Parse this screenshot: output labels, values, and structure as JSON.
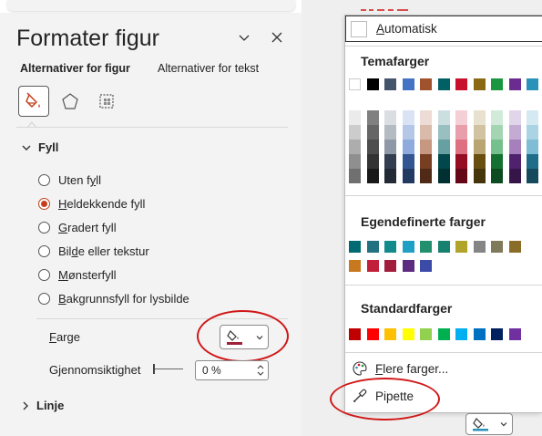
{
  "pane": {
    "title": "Formater figur",
    "tabs": [
      {
        "label": "Alternativer for figur",
        "active": true
      },
      {
        "label": "Alternativer for tekst",
        "active": false
      }
    ],
    "icon_tabs": [
      "fill-line-icon",
      "effects-pentagon-icon",
      "size-properties-icon"
    ],
    "fill_section": {
      "title": "Fyll",
      "expanded": true,
      "options": [
        {
          "label": "Uten fyll",
          "checked": false,
          "u": "y"
        },
        {
          "label": "Heldekkende fyll",
          "checked": true,
          "u": "H"
        },
        {
          "label": "Gradert fyll",
          "checked": false,
          "u": "G"
        },
        {
          "label": "Bilde eller tekstur",
          "checked": false,
          "u": "d"
        },
        {
          "label": "Mønsterfyll",
          "checked": false,
          "u": "M"
        },
        {
          "label": "Bakgrunnsfyll for lysbilde",
          "checked": false,
          "u": "B"
        }
      ],
      "color_label": "Farge",
      "transparency_label": "Gjennomsiktighet",
      "transparency_value": "0 %",
      "transparency_level": 0
    },
    "line_section": {
      "title": "Linje",
      "expanded": false
    }
  },
  "menu": {
    "automatic_label": "Automatisk",
    "theme_header": "Temafarger",
    "custom_header": "Egendefinerte farger",
    "standard_header": "Standardfarger",
    "more_colors_label": "Flere farger...",
    "eyedropper_label": "Pipette",
    "theme_colors": [
      "#ffffff",
      "#000000",
      "#44546a",
      "#4472c4",
      "#a0522d",
      "#006064",
      "#c8102e",
      "#8b6914",
      "#1a9641",
      "#6b2c91",
      "#2a91b8"
    ],
    "custom_colors_row1": [
      "#006a72",
      "#217181",
      "#12898b",
      "#1e9fc4",
      "#22906e",
      "#17806e",
      "#b1a42a",
      "#858585",
      "#7f7a5a",
      "#8b6d2a"
    ],
    "custom_colors_row2": [
      "#c8781e",
      "#c21f3a",
      "#a21d3b",
      "#5c2c80",
      "#3c4aa8"
    ],
    "standard_colors": [
      "#c00000",
      "#ff0000",
      "#ffc000",
      "#ffff00",
      "#92d050",
      "#00b050",
      "#00b0f0",
      "#0070c0",
      "#002060",
      "#7030a0"
    ]
  }
}
